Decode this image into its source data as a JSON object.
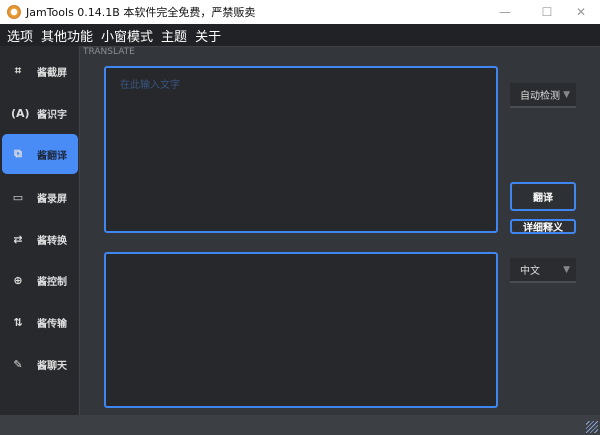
{
  "window": {
    "title": "JamTools 0.14.1B 本软件完全免费，严禁贩卖",
    "minimize": "—",
    "maximize": "☐",
    "close": "✕"
  },
  "menu": [
    "选项",
    "其他功能",
    "小窗模式",
    "主题",
    "关于"
  ],
  "sidebar": [
    {
      "label": "酱截屏",
      "icon": "⌗"
    },
    {
      "label": "酱识字",
      "icon": "(A)"
    },
    {
      "label": "酱翻译",
      "icon": "⧉"
    },
    {
      "label": "酱录屏",
      "icon": "▭"
    },
    {
      "label": "酱转换",
      "icon": "⇄"
    },
    {
      "label": "酱控制",
      "icon": "⊕"
    },
    {
      "label": "酱传输",
      "icon": "⇅"
    },
    {
      "label": "酱聊天",
      "icon": "✎"
    }
  ],
  "translate": {
    "section": "TRANSLATE",
    "input_placeholder": "在此输入文字",
    "input_value": "",
    "output_value": "",
    "source_lang": "自动检测",
    "target_lang": "中文",
    "translate_button": "翻译",
    "detail_button": "详细释义",
    "dropdown_arrow": "▼"
  },
  "colors": {
    "accent": "#3f86f0",
    "active": "#4a8cf6"
  }
}
